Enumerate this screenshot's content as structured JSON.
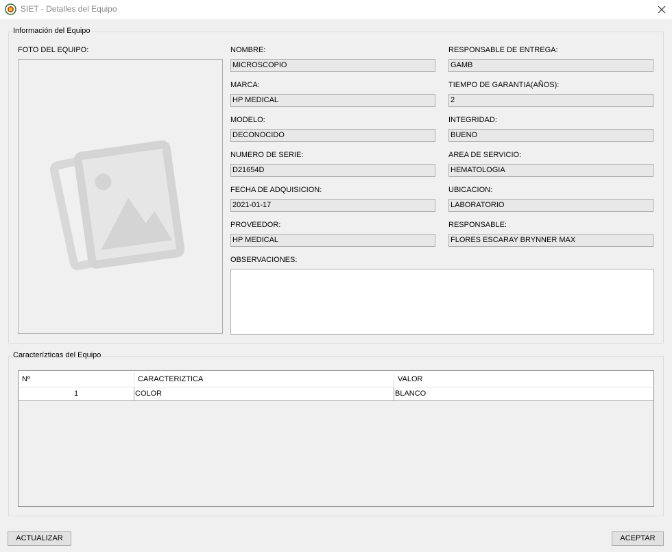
{
  "window": {
    "title": "SIET - Detalles del Equipo",
    "close_icon": "close-icon"
  },
  "info_group": {
    "title": "Información del Equipo",
    "photo_label": "FOTO DEL EQUIPO:",
    "photo_icon": "image-placeholder-icon",
    "fields": {
      "nombre": {
        "label": "NOMBRE:",
        "value": "MICROSCOPIO"
      },
      "marca": {
        "label": "MARCA:",
        "value": "HP MEDICAL"
      },
      "modelo": {
        "label": "MODELO:",
        "value": "DECONOCIDO"
      },
      "serie": {
        "label": "NUMERO DE SERIE:",
        "value": "D21654D"
      },
      "fecha": {
        "label": "FECHA DE ADQUISICION:",
        "value": "2021-01-17"
      },
      "proveedor": {
        "label": "PROVEEDOR:",
        "value": "HP MEDICAL"
      },
      "resp_entrega": {
        "label": "RESPONSABLE DE ENTREGA:",
        "value": "GAMB"
      },
      "garantia": {
        "label": "TIEMPO DE GARANTIA(AÑOS):",
        "value": "2"
      },
      "integridad": {
        "label": "INTEGRIDAD:",
        "value": "BUENO"
      },
      "area": {
        "label": "AREA DE SERVICIO:",
        "value": "HEMATOLOGIA"
      },
      "ubicacion": {
        "label": "UBICACION:",
        "value": "LABORATORIO"
      },
      "responsable": {
        "label": "RESPONSABLE:",
        "value": "FLORES ESCARAY BRYNNER MAX"
      }
    },
    "observaciones_label": "OBSERVACIONES:",
    "observaciones_value": ""
  },
  "features_group": {
    "title": "Caracterízticas del Equipo",
    "columns": [
      "Nº",
      "CARACTERIZTICA",
      "VALOR"
    ],
    "rows": [
      {
        "n": "1",
        "caracteristica": "COLOR",
        "valor": "BLANCO"
      }
    ]
  },
  "buttons": {
    "actualizar": "ACTUALIZAR",
    "aceptar": "ACEPTAR"
  },
  "colors": {
    "window_bg": "#f0f0f0",
    "field_bg": "#e8e8e8",
    "border": "#aeaeae"
  }
}
